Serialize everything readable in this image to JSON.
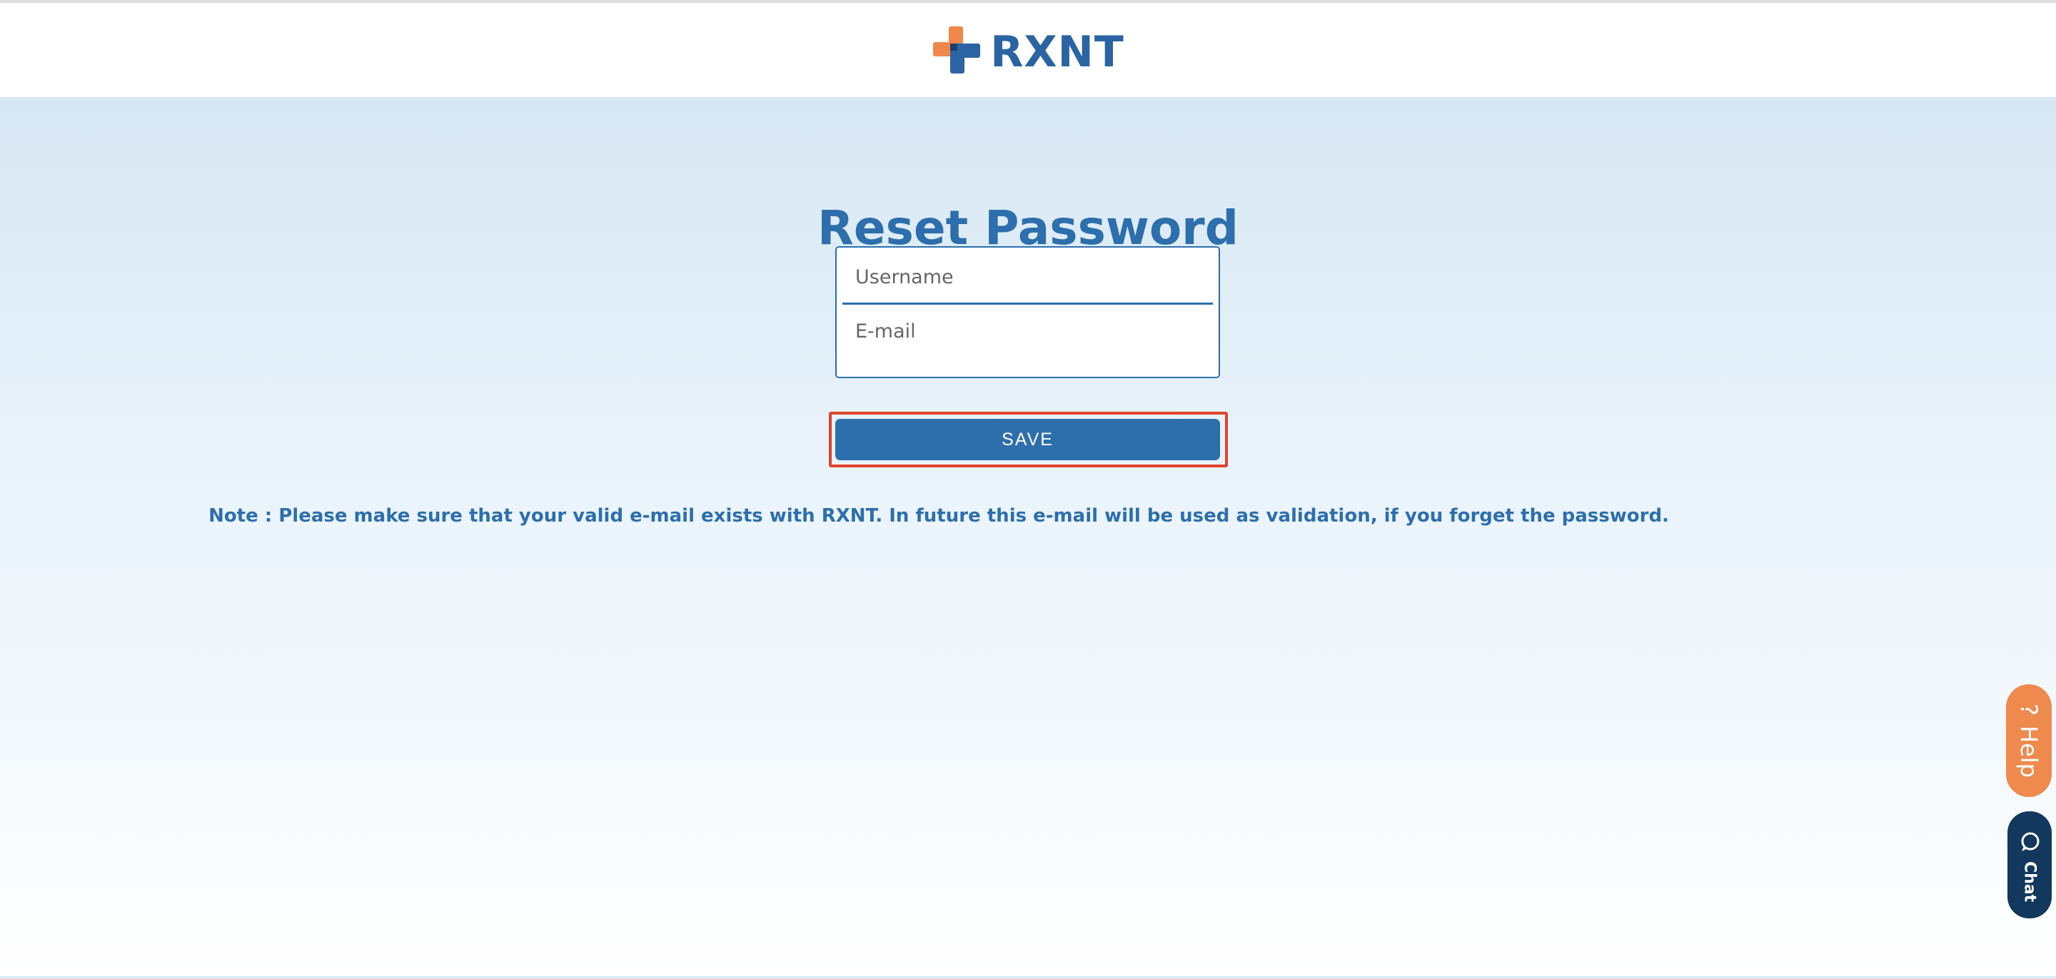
{
  "header": {
    "logo_text": "RXNT",
    "icon": "rxnt-cross-logo"
  },
  "main": {
    "title": "Reset Password",
    "username_placeholder": "Username",
    "email_placeholder": "E-mail",
    "save_label": "SAVE",
    "note": "Note : Please make sure that your valid e-mail exists with RXNT. In future this e-mail will be used as validation, if you forget the password."
  },
  "side_tabs": {
    "help_label": "Help",
    "help_icon_glyph": "?",
    "chat_label": "Chat",
    "chat_icon": "chat-bubble-icon"
  },
  "colors": {
    "brand_blue": "#2d6fad",
    "logo_orange": "#f0884b",
    "help_orange": "#ef8a4e",
    "chat_navy": "#13385d",
    "focus_red": "#e0452c"
  }
}
